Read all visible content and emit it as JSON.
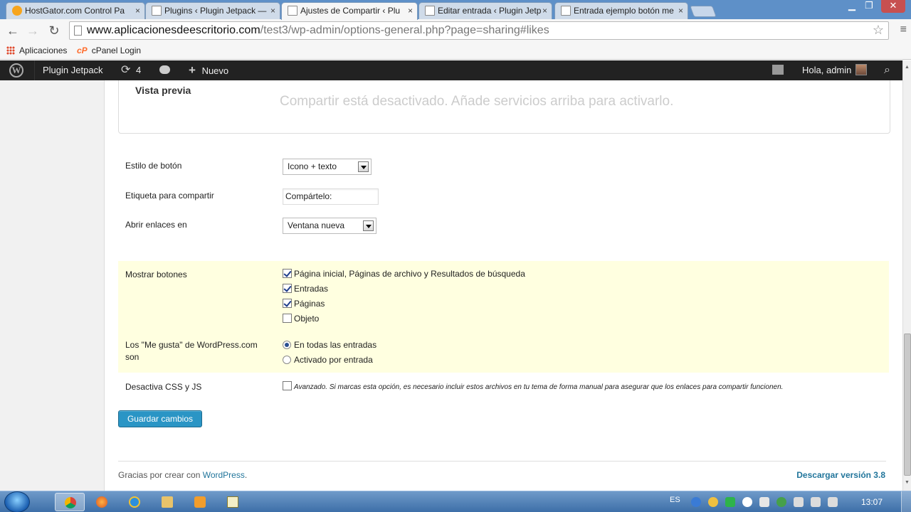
{
  "browser": {
    "tabs": [
      {
        "title": "HostGator.com Control Pa",
        "icon": "hostgator-icon"
      },
      {
        "title": "Plugins ‹ Plugin Jetpack —",
        "icon": "page-icon"
      },
      {
        "title": "Ajustes de Compartir ‹ Plu",
        "icon": "page-icon",
        "active": true
      },
      {
        "title": "Editar entrada ‹ Plugin Jetp",
        "icon": "page-icon"
      },
      {
        "title": "Entrada ejemplo botón me",
        "icon": "page-icon"
      }
    ],
    "tab_close": "×",
    "window_controls": {
      "minimize": "▁",
      "restore": "❐",
      "close": "✕"
    },
    "url_host": "www.aplicacionesdeescritorio.com",
    "url_path": "/test3/wp-admin/options-general.php?page=sharing#likes",
    "nav": {
      "back": "←",
      "forward": "→",
      "reload": "↻",
      "star": "☆",
      "menu": "≡"
    },
    "bookmarks": {
      "apps": "Aplicaciones",
      "cp_logo": "cP",
      "cpanel": "cPanel Login"
    }
  },
  "adminbar": {
    "wp_logo": "W",
    "site": "Plugin Jetpack",
    "updates_icon": "⟳",
    "updates_count": "4",
    "new_icon": "+",
    "new_label": "Nuevo",
    "greeting": "Hola, admin",
    "search_icon": "⌕"
  },
  "preview": {
    "title": "Vista previa",
    "message": "Compartir está desactivado. Añade servicios arriba para activarlo."
  },
  "settings": {
    "button_style_label": "Estilo de botón",
    "button_style_value": "Icono + texto",
    "share_label_label": "Etiqueta para compartir",
    "share_label_value": "Compártelo:",
    "open_links_label": "Abrir enlaces en",
    "open_links_value": "Ventana nueva",
    "show_buttons_label": "Mostrar botones",
    "show_buttons_options": [
      {
        "label": "Página inicial, Páginas de archivo y Resultados de búsqueda",
        "checked": true
      },
      {
        "label": "Entradas",
        "checked": true
      },
      {
        "label": "Páginas",
        "checked": true
      },
      {
        "label": "Objeto",
        "checked": false
      }
    ],
    "likes_label": "Los \"Me gusta\" de WordPress.com son",
    "likes_options": [
      {
        "label": "En todas las entradas",
        "selected": true
      },
      {
        "label": "Activado por entrada",
        "selected": false
      }
    ],
    "disable_css_label": "Desactiva CSS y JS",
    "disable_css_checked": false,
    "disable_css_desc": "Avanzado. Si marcas esta opción, es necesario incluir estos archivos en tu tema de forma manual para asegurar que los enlaces para compartir funcionen."
  },
  "save_button": "Guardar cambios",
  "footer": {
    "thanks_prefix": "Gracias por crear con ",
    "thanks_link": "WordPress",
    "thanks_suffix": ".",
    "download": "Descargar versión 3.8"
  },
  "scrollbar": {
    "up": "▲",
    "down": "▼"
  },
  "taskbar": {
    "lang": "ES",
    "time": "13:07"
  },
  "colors": {
    "wp_blue": "#21759b",
    "button_blue": "#2a95c5",
    "highlight": "#ffffe0",
    "adminbar": "#222222"
  }
}
